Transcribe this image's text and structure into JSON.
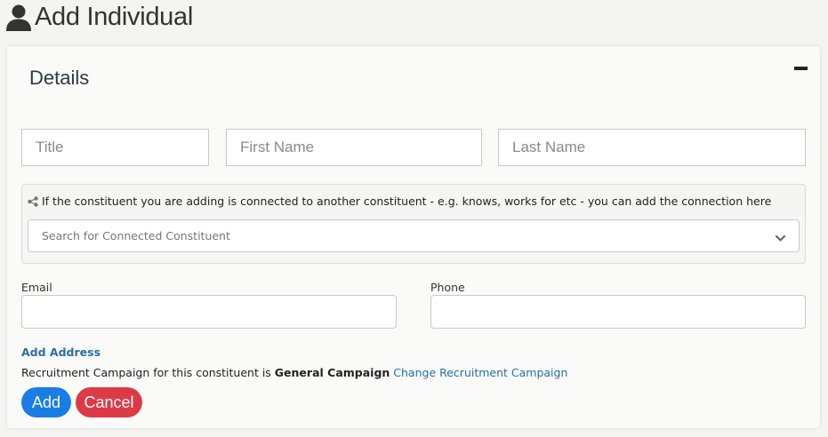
{
  "header": {
    "title": "Add Individual",
    "icon": "user-icon"
  },
  "card": {
    "title": "Details",
    "collapse_icon": "minus-icon"
  },
  "name_fields": {
    "title_placeholder": "Title",
    "first_name_placeholder": "First Name",
    "last_name_placeholder": "Last Name"
  },
  "connection": {
    "info_text": "If the constituent you are adding is connected to another constituent - e.g. knows, works for etc - you can add the connection here",
    "search_placeholder": "Search for Connected Constituent",
    "icon": "share-icon"
  },
  "contact": {
    "email_label": "Email",
    "phone_label": "Phone",
    "email_value": "",
    "phone_value": ""
  },
  "add_address_label": "Add Address",
  "recruitment": {
    "prefix": "Recruitment Campaign for this constituent is ",
    "campaign": "General Campaign",
    "change_link": "Change Recruitment Campaign"
  },
  "buttons": {
    "add": "Add",
    "cancel": "Cancel"
  },
  "colors": {
    "primary": "#1a7de6",
    "danger": "#dd3a47",
    "link": "#2a6ea8"
  }
}
